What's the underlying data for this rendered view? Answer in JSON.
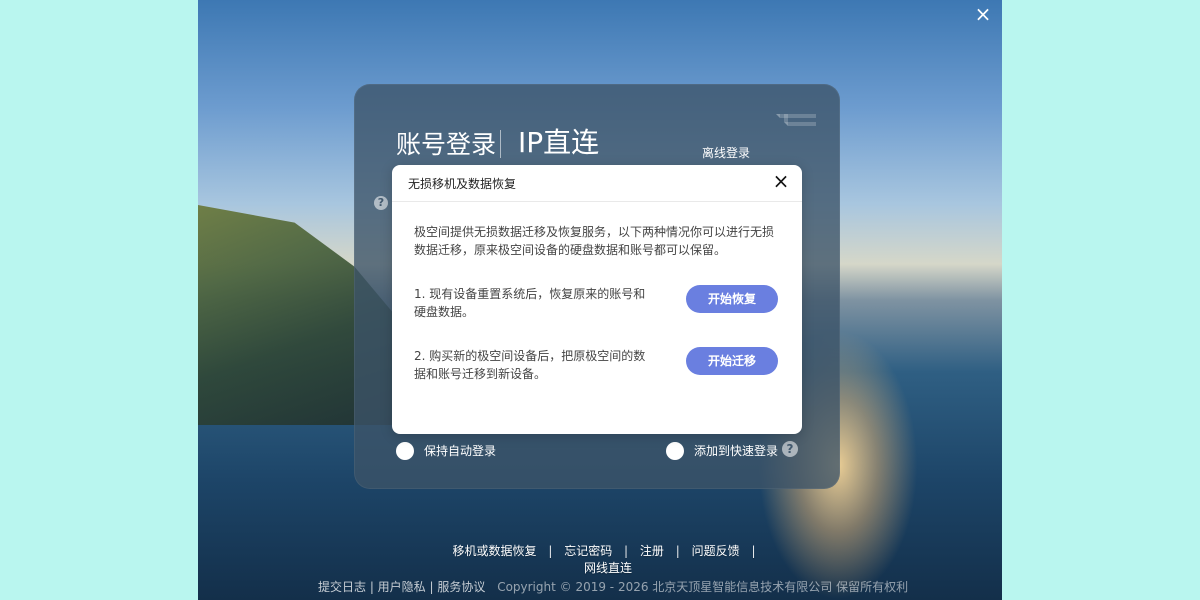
{
  "window": {
    "close_icon": "×"
  },
  "login": {
    "tab_account": "账号登录",
    "tab_ip": "IP直连",
    "offline_login": "离线登录",
    "help_left": "?",
    "remember_label": "保持自动登录",
    "quick_label": "添加到快速登录",
    "help_right": "?"
  },
  "modal": {
    "title": "无损移机及数据恢复",
    "close_icon": "×",
    "intro": "极空间提供无损数据迁移及恢复服务，以下两种情况你可以进行无损数据迁移，原来极空间设备的硬盘数据和账号都可以保留。",
    "options": [
      {
        "text": "1. 现有设备重置系统后，恢复原来的账号和硬盘数据。",
        "button": "开始恢复"
      },
      {
        "text": "2. 购买新的极空间设备后，把原极空间的数据和账号迁移到新设备。",
        "button": "开始迁移"
      }
    ]
  },
  "bottom_links": [
    "移机或数据恢复",
    "忘记密码",
    "注册",
    "问题反馈",
    "网线直连"
  ],
  "footer": {
    "links": "提交日志 | 用户隐私 | 服务协议",
    "copyright": "Copyright © 2019 - 2026 北京天顶星智能信息技术有限公司 保留所有权利"
  }
}
